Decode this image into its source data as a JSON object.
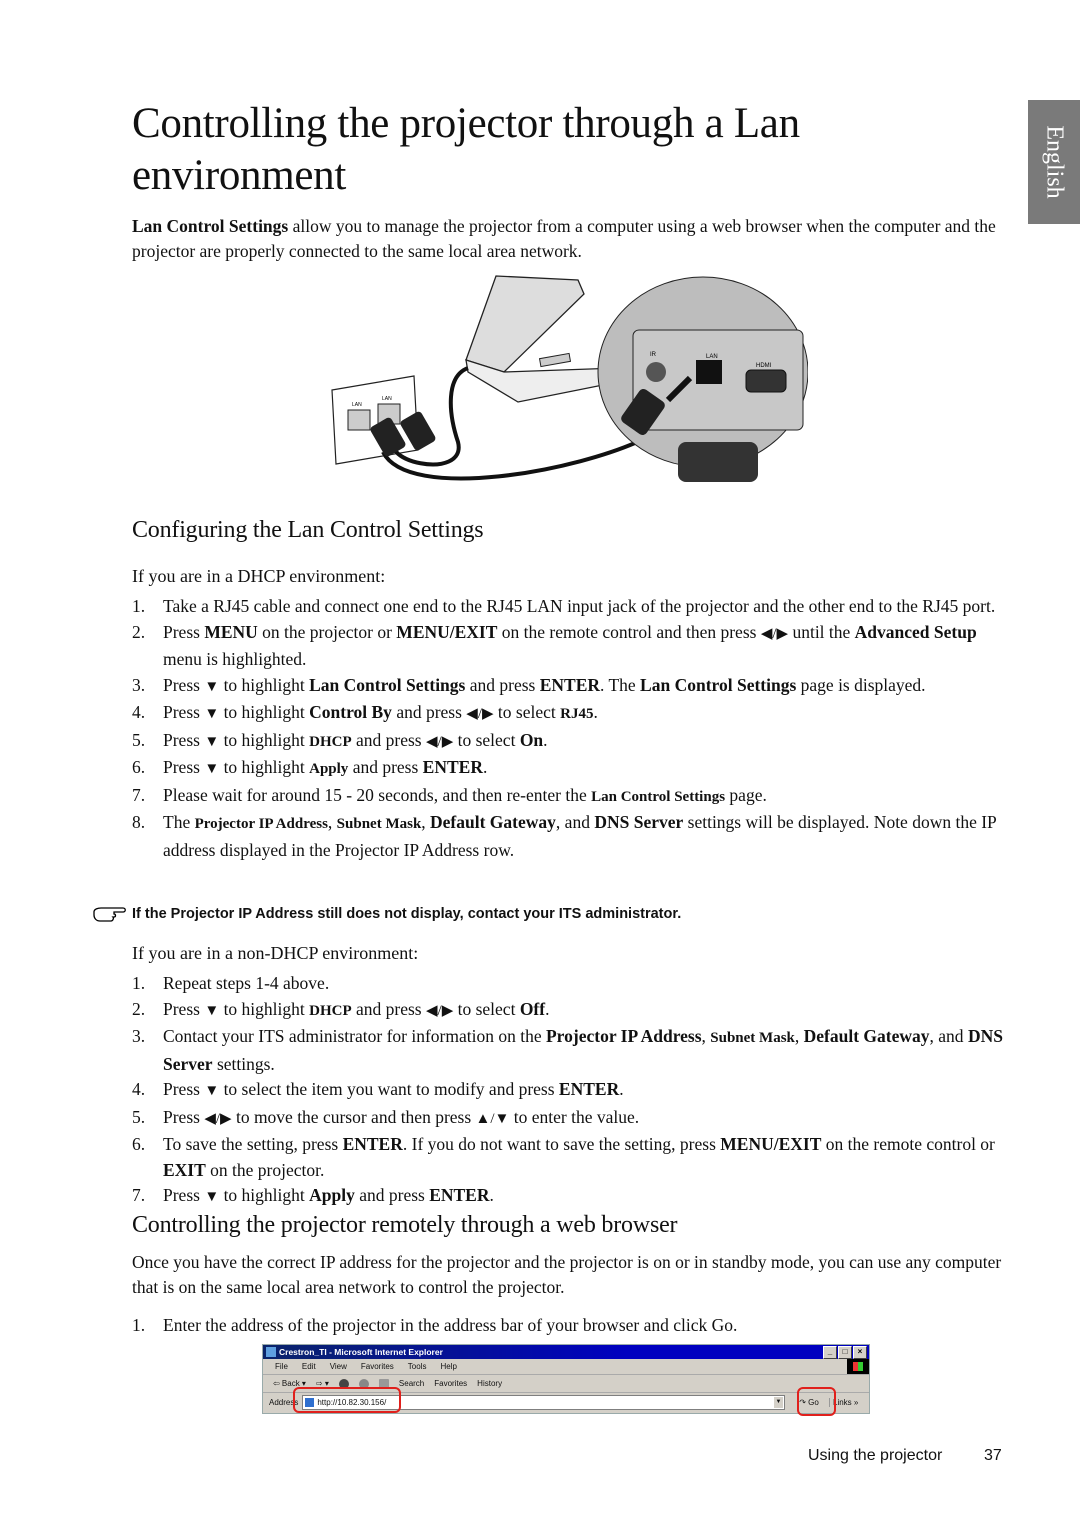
{
  "page": {
    "title_line1": "Controlling the projector through a Lan",
    "title_line2": "environment",
    "language_tab": "English",
    "intro": {
      "bold": "Lan Control Settings",
      "rest": " allow you to manage the projector from a computer using a web browser when the computer and the projector are properly connected to the same local area network."
    },
    "figure": {
      "description": "Laptop connected via RJ45 cables to wall LAN port and projector LAN jack",
      "labels": [
        "LAN",
        "LAN",
        "IR",
        "LAN",
        "HDMI"
      ]
    }
  },
  "section_config": {
    "heading": "Configuring the Lan Control Settings",
    "dhcp": {
      "heading": "If you are in a DHCP environment:",
      "steps": [
        {
          "num": "1.",
          "html": "Take a RJ45 cable and connect one end to the RJ45 LAN input jack of the projector and the other end to the RJ45 port."
        },
        {
          "num": "2.",
          "html": "Press <b>MENU</b> on the projector or <b>MENU/EXIT</b> on the remote control and then press <span class='tri'>◀/▶</span> until the <b>Advanced Setup</b> menu is highlighted."
        },
        {
          "num": "3.",
          "html": "Press <span class='tri'>▼</span> to highlight <b>Lan Control Settings</b> and press <b>ENTER</b>. The <b>Lan Control Settings</b> page is displayed."
        },
        {
          "num": "4.",
          "html": "Press <span class='tri'>▼</span> to highlight <b>Control By</b> and press <span class='tri'>◀/▶</span> to select <b class='sm'>RJ45</b>."
        },
        {
          "num": "5.",
          "html": "Press <span class='tri'>▼</span> to highlight <b class='sm'>DHCP</b> and press <span class='tri'>◀/▶</span> to select <b>On</b>."
        },
        {
          "num": "6.",
          "html": "Press <span class='tri'>▼</span> to highlight <b class='sm'>Apply</b> and press <b>ENTER</b>."
        },
        {
          "num": "7.",
          "html": "Please wait for around 15 - 20 seconds, and then re-enter the <b class='sm'>Lan Control Settings</b> page."
        },
        {
          "num": "8.",
          "html": "The <b class='sm'>Projector IP Address</b>, <b class='sm'>Subnet Mask</b>, <b>Default Gateway</b>, and <b>DNS Server</b> settings will be displayed. Note down the IP address displayed in the Projector IP Address row."
        }
      ],
      "note": "If the Projector IP Address still does not display, contact your ITS administrator."
    },
    "non_dhcp": {
      "heading": "If you are in a non-DHCP environment:",
      "steps": [
        {
          "num": "1.",
          "html": "Repeat steps 1-4 above."
        },
        {
          "num": "2.",
          "html": "Press <span class='tri'>▼</span> to highlight <b class='sm'>DHCP</b> and press <span class='tri'>◀/▶</span> to select <b>Off</b>."
        },
        {
          "num": "3.",
          "html": "Contact your ITS administrator for information on the <b>Projector IP Address</b>, <b class='sm'>Subnet Mask</b>, <b>Default Gateway</b>, and <b>DNS Server</b> settings."
        },
        {
          "num": "4.",
          "html": "Press <span class='tri'>▼</span> to select the item you want to modify and press <b>ENTER</b>."
        },
        {
          "num": "5.",
          "html": "Press <span class='tri'>◀/▶</span> to move the cursor and then press <span class='tri'>▲/▼</span> to enter the value."
        },
        {
          "num": "6.",
          "html": "To save the setting, press <b>ENTER</b>. If you do not want to save the setting, press <b>MENU/EXIT</b> on the remote control or <b>EXIT</b> on the projector."
        },
        {
          "num": "7.",
          "html": "Press <span class='tri'>▼</span> to highlight <b>Apply</b> and press <b>ENTER</b>."
        }
      ]
    }
  },
  "section_web": {
    "heading": "Controlling the projector remotely through a web browser",
    "intro": "Once you have the correct IP address for the projector and the projector is on or in standby mode, you can use any computer that is on the same local area network to control the projector.",
    "steps": [
      {
        "num": "1.",
        "html": "Enter the address of the projector in the address bar of your browser and click Go."
      }
    ],
    "browser": {
      "window_title": "Crestron_TI - Microsoft Internet Explorer",
      "menu": [
        "File",
        "Edit",
        "View",
        "Favorites",
        "Tools",
        "Help"
      ],
      "toolbar": [
        "⇦ Back ▾",
        "⇨ ▾",
        "Search",
        "Favorites",
        "History"
      ],
      "address_label": "Address",
      "address_value": "http://10.82.30.156/",
      "go_label": "Go",
      "links_label": "Links »",
      "highlight_color": "#e0201c"
    }
  },
  "footer": {
    "section": "Using the projector",
    "page_number": "37"
  }
}
